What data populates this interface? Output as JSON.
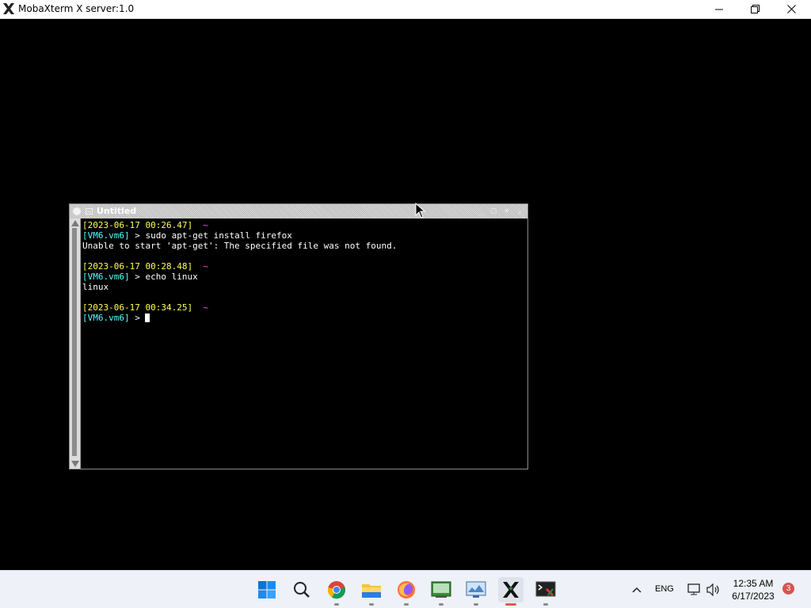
{
  "host": {
    "title": "MobaXterm X server:1.0",
    "controls": [
      "minimize",
      "maximize",
      "close"
    ]
  },
  "xwindow": {
    "title": "Untitled"
  },
  "terminal": {
    "lines": [
      {
        "type": "prompt_ts",
        "ts": "[2023-06-17 00:26.47]",
        "tilde": "~"
      },
      {
        "type": "command",
        "host": "[VM6.vm6]",
        "sep": " > ",
        "cmd": "sudo apt-get install firefox"
      },
      {
        "type": "output",
        "text": "Unable to start 'apt-get': The specified file was not found."
      },
      {
        "type": "blank"
      },
      {
        "type": "prompt_ts",
        "ts": "[2023-06-17 00:28.48]",
        "tilde": "~"
      },
      {
        "type": "command",
        "host": "[VM6.vm6]",
        "sep": " > ",
        "cmd": "echo linux"
      },
      {
        "type": "output",
        "text": "linux"
      },
      {
        "type": "blank"
      },
      {
        "type": "prompt_ts",
        "ts": "[2023-06-17 00:34.25]",
        "tilde": "~"
      },
      {
        "type": "command",
        "host": "[VM6.vm6]",
        "sep": " > ",
        "cmd": "",
        "cursor": true
      }
    ]
  },
  "taskbar": {
    "apps": [
      "start-icon",
      "search-icon",
      "chrome-icon",
      "file-explorer-icon",
      "firefox-icon",
      "terminal-app-icon",
      "monitor-app-icon",
      "mobaxterm-x-icon",
      "mobaxterm-icon"
    ],
    "tray": {
      "language": "ENG",
      "time": "12:35 AM",
      "date": "6/17/2023",
      "notifications": "3"
    }
  }
}
